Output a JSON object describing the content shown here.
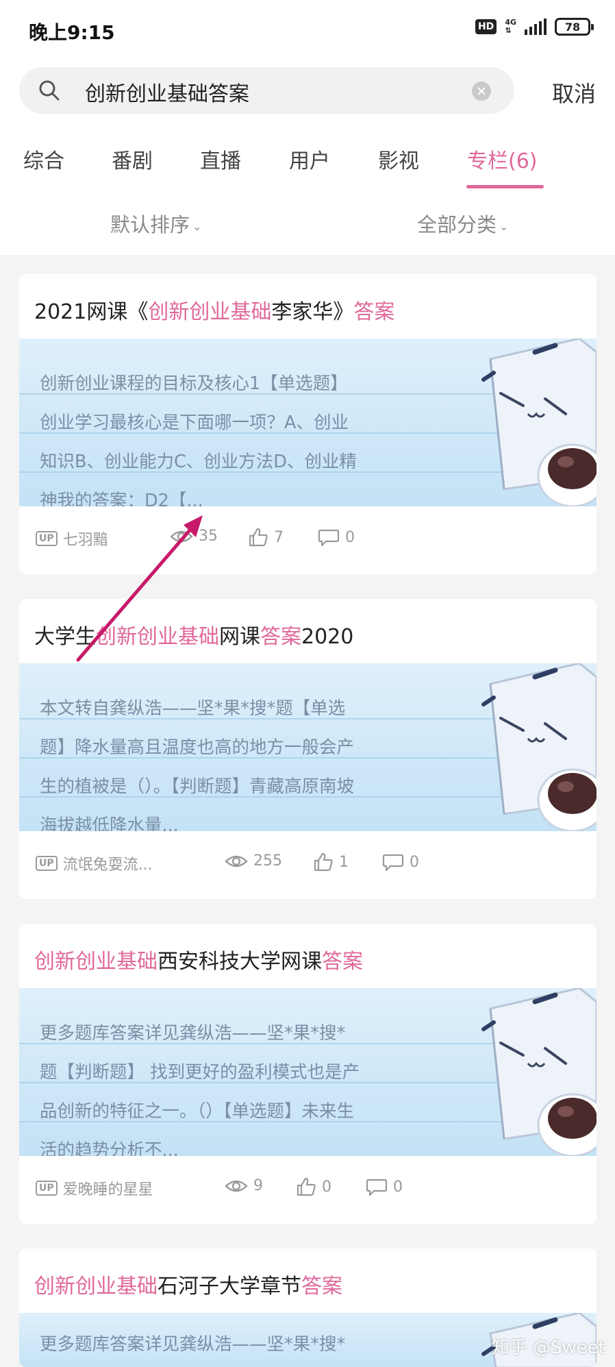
{
  "status_bar": {
    "time": "晚上9:15",
    "hd": "HD",
    "network": "4G",
    "battery": "78"
  },
  "search": {
    "query": "创新创业基础答案",
    "cancel_label": "取消"
  },
  "tabs": [
    {
      "label": "综合"
    },
    {
      "label": "番剧"
    },
    {
      "label": "直播"
    },
    {
      "label": "用户"
    },
    {
      "label": "影视"
    },
    {
      "label": "专栏(6)",
      "active": true
    }
  ],
  "filters": {
    "sort": "默认排序",
    "category": "全部分类"
  },
  "colors": {
    "accent": "#e0689a",
    "text": "#212121",
    "muted": "#9a9a9a",
    "annotation_arrow": "#c8196a"
  },
  "icons": {
    "up": "up-badge-icon",
    "views": "eye-icon",
    "likes": "thumbs-up-icon",
    "comments": "comment-icon"
  },
  "articles": [
    {
      "title_parts": [
        "2021网课《",
        "创新创业基础",
        "李家华》",
        "答案"
      ],
      "excerpt": "创新创业课程的目标及核心1【单选题】创业学习最核心是下面哪一项？A、创业知识B、创业能力C、创业方法D、创业精神我的答案：D2【...",
      "author": "七羽黯",
      "views": "35",
      "likes": "7",
      "comments": "0"
    },
    {
      "title_parts": [
        "大学生",
        "创新创业基础",
        "网课",
        "答案",
        "2020"
      ],
      "excerpt": "本文转自龚纵浩——坚*果*搜*题【单选题】降水量高且温度也高的地方一般会产生的植被是（）。【判断题】青藏高原南坡海拔越低降水量...",
      "author": "流氓兔耍流...",
      "views": "255",
      "likes": "1",
      "comments": "0"
    },
    {
      "title_parts": [
        "创新创业基础",
        "西安科技大学网课",
        "答案"
      ],
      "excerpt": "更多题库答案详见龚纵浩——坚*果*搜*题【判断题】 找到更好的盈利模式也是产品创新的特征之一。（）【单选题】未来生活的趋势分析不...",
      "author": "爱晚睡的星星",
      "views": "9",
      "likes": "0",
      "comments": "0"
    },
    {
      "title_parts": [
        "创新创业基础",
        "石河子大学章节",
        "答案"
      ],
      "excerpt": "更多题库答案详见龚纵浩——坚*果*搜*题【单选"
    }
  ],
  "watermark": "知乎 @Sweet"
}
